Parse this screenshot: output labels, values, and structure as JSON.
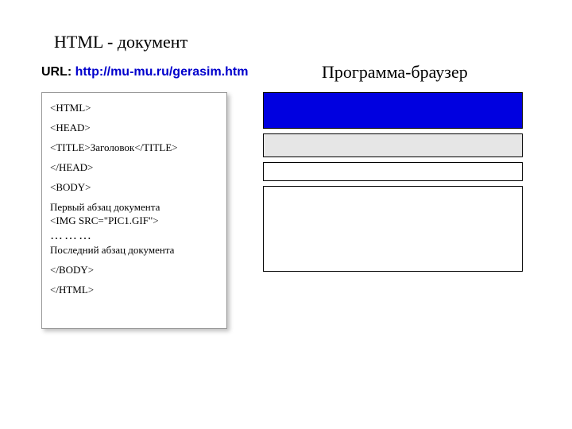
{
  "heading_left": "HTML - документ",
  "url_label": "URL: ",
  "url_value": "http://mu-mu.ru/gerasim.htm",
  "heading_right": "Программа-браузер",
  "code": {
    "l1": "<HTML>",
    "l2": "<HEAD>",
    "l3": "<TITLE>Заголовок</TITLE>",
    "l4": "</HEAD>",
    "l5": "<BODY>",
    "l6": "Первый абзац документа",
    "l7": "<IMG SRC=\"PIC1.GIF\">",
    "l8": "………",
    "l9": "Последний абзац документа",
    "l10": "</BODY>",
    "l11": "</HTML>"
  }
}
